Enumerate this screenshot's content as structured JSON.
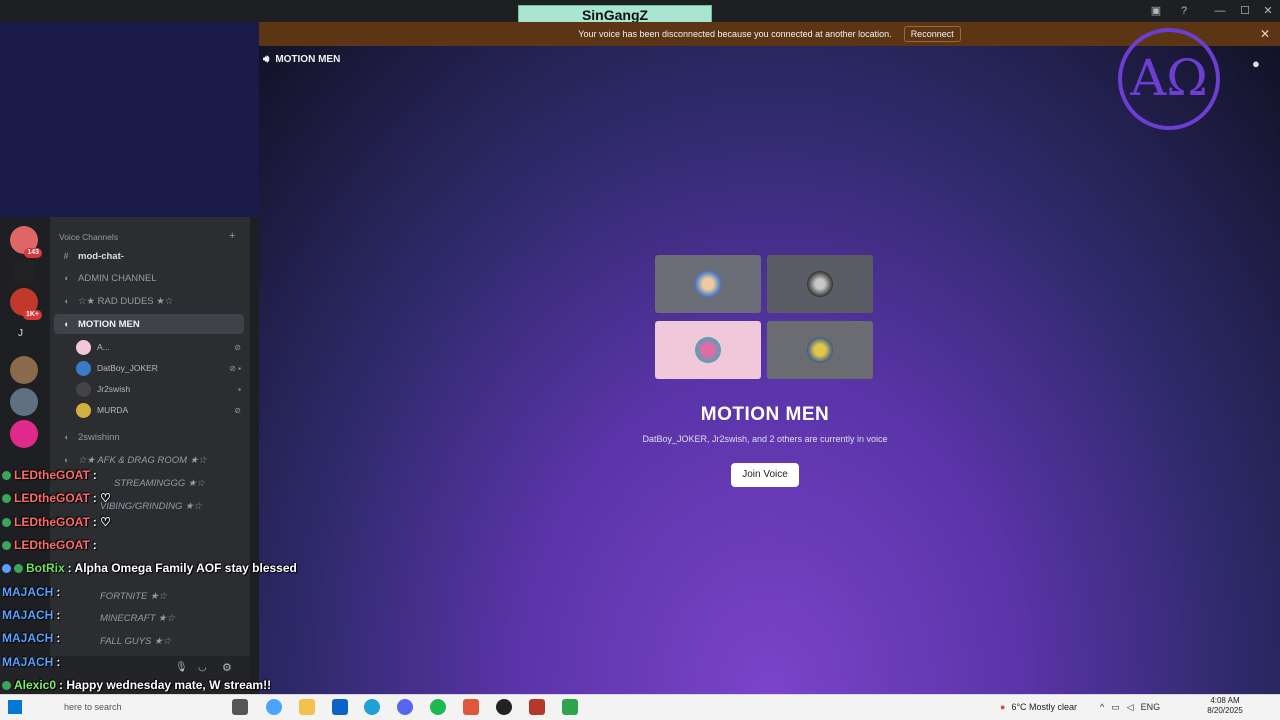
{
  "window": {
    "stream_title": "SinGangZ"
  },
  "notice": {
    "message": "Your voice has been disconnected because you connected at another location.",
    "reconnect_label": "Reconnect"
  },
  "stage": {
    "header": "MOTION MEN",
    "channel_name": "MOTION MEN",
    "in_voice_text": "DatBoy_JOKER, Jr2swish, and 2 others are currently in voice",
    "join_label": "Join Voice"
  },
  "sidebar": {
    "section_label": "Voice Channels",
    "channels": [
      {
        "label": "mod-chat-"
      },
      {
        "label": "ADMIN CHANNEL"
      },
      {
        "label": "☆★ RAD DUDES ★☆"
      },
      {
        "label": "MOTION MEN"
      },
      {
        "label": "2swishinn"
      },
      {
        "label": "☆★ AFK & DRAG ROOM ★☆"
      },
      {
        "label": "STREAMINGGG ★☆"
      },
      {
        "label": "VIBING/GRINDING ★☆"
      },
      {
        "label": "FORTNITE ★☆"
      },
      {
        "label": "MINECRAFT ★☆"
      },
      {
        "label": "FALL GUYS ★☆"
      }
    ],
    "members": [
      {
        "name": "A..."
      },
      {
        "name": "DatBoy_JOKER"
      },
      {
        "name": "Jr2swish"
      },
      {
        "name": "MURDA"
      }
    ],
    "server_badges": [
      "143",
      "1K+",
      "J"
    ]
  },
  "chat": [
    {
      "user": "LEDtheGOAT",
      "message": ":"
    },
    {
      "user": "LEDtheGOAT",
      "message": ": ♡"
    },
    {
      "user": "LEDtheGOAT",
      "message": ": ♡"
    },
    {
      "user": "LEDtheGOAT",
      "message": ":"
    },
    {
      "user": "BotRix",
      "message": ": Alpha Omega Family AOF stay blessed"
    },
    {
      "user": "MAJACH",
      "message": ":"
    },
    {
      "user": "MAJACH",
      "message": ":"
    },
    {
      "user": "MAJACH",
      "message": ":"
    },
    {
      "user": "MAJACH",
      "message": ":"
    },
    {
      "user": "Alexic0",
      "message": ": Happy wednesday mate, W stream!!"
    }
  ],
  "taskbar": {
    "search_placeholder": "here to search",
    "weather": "6°C  Mostly clear",
    "language": "ENG",
    "time": "4:08 AM",
    "date": "8/20/2025"
  },
  "colors": {
    "notice_bg": "#5c3514",
    "accent_purple": "#6b3fd1",
    "tile_pink": "#f1c7da"
  }
}
